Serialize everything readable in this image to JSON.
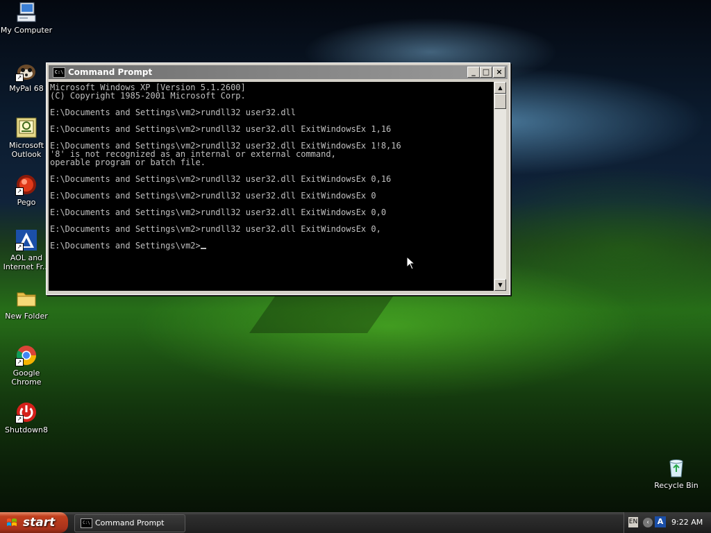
{
  "desktop": {
    "icons": [
      {
        "label": "My Computer"
      },
      {
        "label": "MyPal 68"
      },
      {
        "label": "Microsoft Outlook"
      },
      {
        "label": "Pego"
      },
      {
        "label": "AOL and Internet Fr..."
      },
      {
        "label": "New Folder"
      },
      {
        "label": "Google Chrome"
      },
      {
        "label": "Shutdown8"
      },
      {
        "label": "Recycle Bin"
      }
    ]
  },
  "window": {
    "title": "Command Prompt",
    "icon_text": "C:\\",
    "buttons": {
      "minimize": "_",
      "maximize": "□",
      "close": "×"
    },
    "console_lines": [
      "Microsoft Windows XP [Version 5.1.2600]",
      "(C) Copyright 1985-2001 Microsoft Corp.",
      "",
      "E:\\Documents and Settings\\vm2>rundll32 user32.dll",
      "",
      "E:\\Documents and Settings\\vm2>rundll32 user32.dll ExitWindowsEx 1,16",
      "",
      "E:\\Documents and Settings\\vm2>rundll32 user32.dll ExitWindowsEx 1!8,16",
      "'8' is not recognized as an internal or external command,",
      "operable program or batch file.",
      "",
      "E:\\Documents and Settings\\vm2>rundll32 user32.dll ExitWindowsEx 0,16",
      "",
      "E:\\Documents and Settings\\vm2>rundll32 user32.dll ExitWindowsEx 0",
      "",
      "E:\\Documents and Settings\\vm2>rundll32 user32.dll ExitWindowsEx 0,0",
      "",
      "E:\\Documents and Settings\\vm2>rundll32 user32.dll ExitWindowsEx 0,",
      ""
    ],
    "prompt": "E:\\Documents and Settings\\vm2>"
  },
  "taskbar": {
    "start_label": "start",
    "task_button_label": "Command Prompt",
    "tray": {
      "language": "EN",
      "clock": "9:22 AM"
    }
  },
  "colors": {
    "console_bg": "#000000",
    "console_fg": "#c0c0c0",
    "start_button": "#c2401e"
  }
}
